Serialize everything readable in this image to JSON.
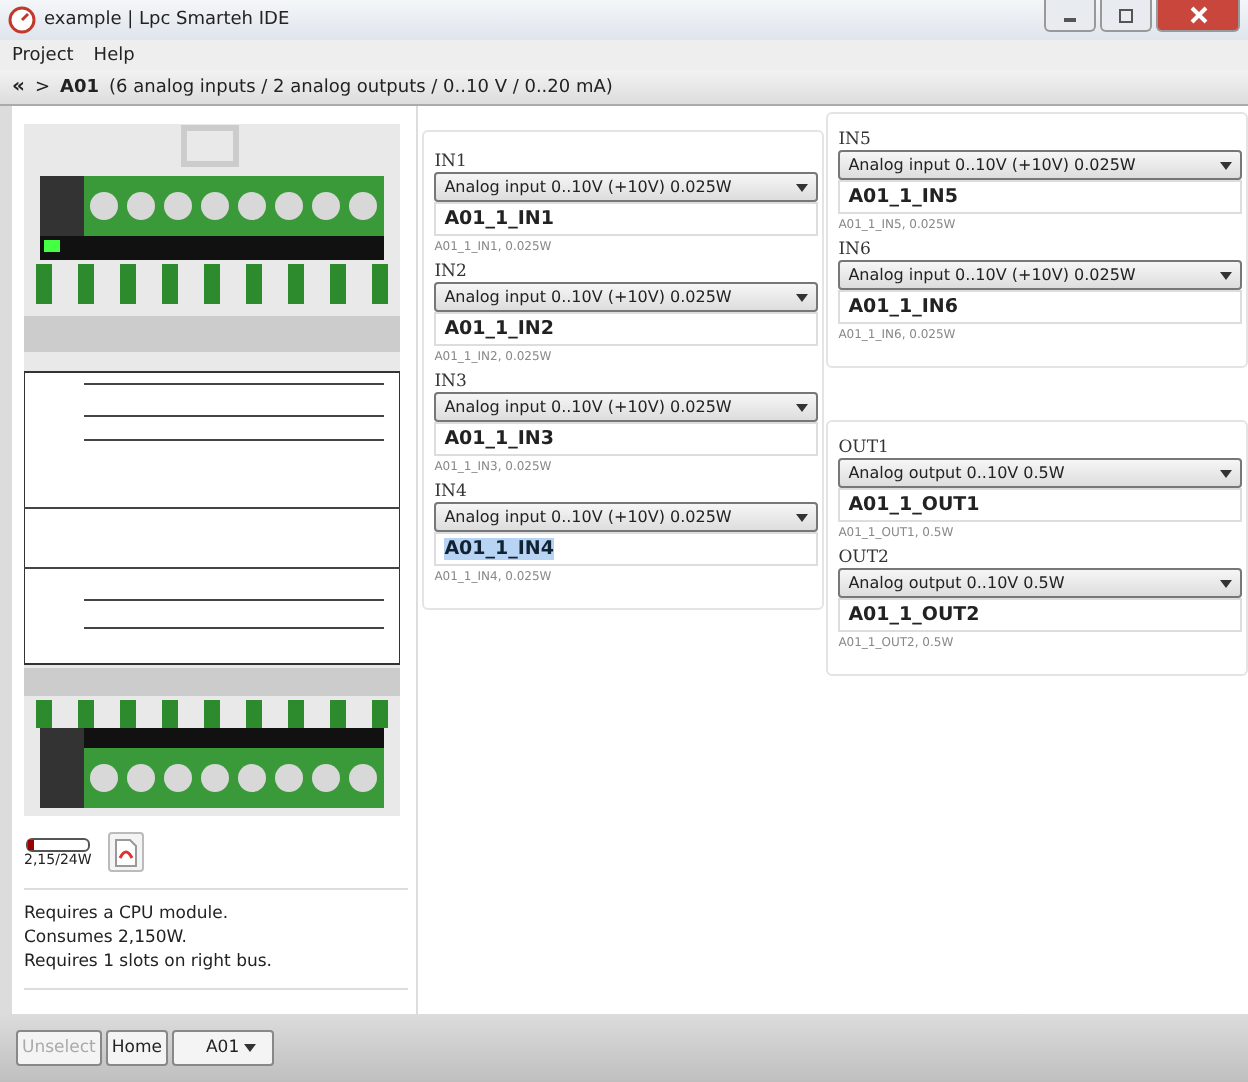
{
  "window": {
    "title": "example | Lpc Smarteh IDE"
  },
  "menu": [
    "Project",
    "Help"
  ],
  "breadcrumb": {
    "back": "«",
    "separator": ">",
    "module": "A01",
    "description": "(6 analog inputs / 2 analog outputs / 0..10 V / 0..20 mA)"
  },
  "power": {
    "level": 0.09,
    "reading": "2,15/24W"
  },
  "info": [
    "Requires a CPU module.",
    "Consumes 2,150W.",
    "Requires 1 slots on right bus."
  ],
  "columns": [
    {
      "groups": [
        {
          "channels": [
            {
              "label": "IN1",
              "type": "Analog input 0..10V (+10V) 0.025W",
              "name": "A01_1_IN1",
              "detail": "A01_1_IN1, 0.025W",
              "selected": false
            },
            {
              "label": "IN2",
              "type": "Analog input 0..10V (+10V) 0.025W",
              "name": "A01_1_IN2",
              "detail": "A01_1_IN2, 0.025W",
              "selected": false
            },
            {
              "label": "IN3",
              "type": "Analog input 0..10V (+10V) 0.025W",
              "name": "A01_1_IN3",
              "detail": "A01_1_IN3, 0.025W",
              "selected": false
            },
            {
              "label": "IN4",
              "type": "Analog input 0..10V (+10V) 0.025W",
              "name": "A01_1_IN4",
              "detail": "A01_1_IN4, 0.025W",
              "selected": true
            }
          ]
        }
      ]
    },
    {
      "groups": [
        {
          "channels": [
            {
              "label": "IN5",
              "type": "Analog input 0..10V (+10V) 0.025W",
              "name": "A01_1_IN5",
              "detail": "A01_1_IN5, 0.025W",
              "selected": false
            },
            {
              "label": "IN6",
              "type": "Analog input 0..10V (+10V) 0.025W",
              "name": "A01_1_IN6",
              "detail": "A01_1_IN6, 0.025W",
              "selected": false
            }
          ]
        },
        {
          "channels": [
            {
              "label": "OUT1",
              "type": "Analog output 0..10V 0.5W",
              "name": "A01_1_OUT1",
              "detail": "A01_1_OUT1, 0.5W",
              "selected": false
            },
            {
              "label": "OUT2",
              "type": "Analog output 0..10V 0.5W",
              "name": "A01_1_OUT2",
              "detail": "A01_1_OUT2, 0.5W",
              "selected": false
            }
          ]
        }
      ]
    }
  ],
  "toolbar": [
    {
      "label": "Unselect",
      "kind": "button",
      "disabled": true
    },
    {
      "label": "Home",
      "kind": "button",
      "disabled": false
    },
    {
      "label": "A01",
      "kind": "dropdown",
      "disabled": false
    }
  ]
}
